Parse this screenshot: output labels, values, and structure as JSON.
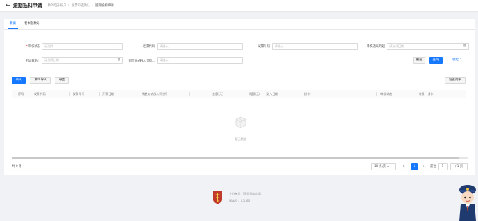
{
  "header": {
    "title": "逾期抵扣申请",
    "breadcrumb": [
      "我的电子账户",
      "发票勾选确认",
      "逾期抵扣申请"
    ]
  },
  "tabs": [
    {
      "label": "我要",
      "active": true
    },
    {
      "label": "着木题数号",
      "active": false
    }
  ],
  "form": {
    "row1": [
      {
        "label": "审核状态",
        "required": true,
        "placeholder": "请选择",
        "type": "select"
      },
      {
        "label": "发票代码",
        "required": false,
        "placeholder": "请输入",
        "type": "text"
      },
      {
        "label": "发票号码",
        "required": false,
        "placeholder": "请输入",
        "type": "text"
      },
      {
        "label": "审核通知期起",
        "required": false,
        "placeholder": "请选择日期",
        "type": "date"
      }
    ],
    "row2": [
      {
        "label": "申请日期止",
        "required": false,
        "placeholder": "请选择日期",
        "type": "date"
      },
      {
        "label": "销售方纳税人识别...",
        "required": false,
        "placeholder": "请输入",
        "type": "text"
      }
    ],
    "buttons": {
      "reset": "重置",
      "query": "查询",
      "collapse": "收起"
    }
  },
  "toolbar": {
    "add": "录入",
    "batch_import": "清单导入",
    "export": "导出",
    "column_setting": "设置列表"
  },
  "table": {
    "columns": [
      "序号",
      "发票代码",
      "发票号码",
      "开票日期",
      "销售方纳税人识别号",
      "金额(元)",
      "税额(元)",
      "录入日期",
      "操作",
      "审核状态",
      "申报",
      "操作"
    ],
    "empty_text": "暂无数据"
  },
  "pagination": {
    "total": "共 0 条",
    "page_size": "10 条/页",
    "current_page": "1",
    "goto_label": "前往",
    "goto_value": "1",
    "pages": "/ 1 页"
  },
  "footer": {
    "line1": "主办单位：国家税务总局",
    "line2": "版本号：1.1.66"
  },
  "colors": {
    "primary": "#1677ff",
    "background": "#f0f2f5",
    "required": "#e33333"
  }
}
